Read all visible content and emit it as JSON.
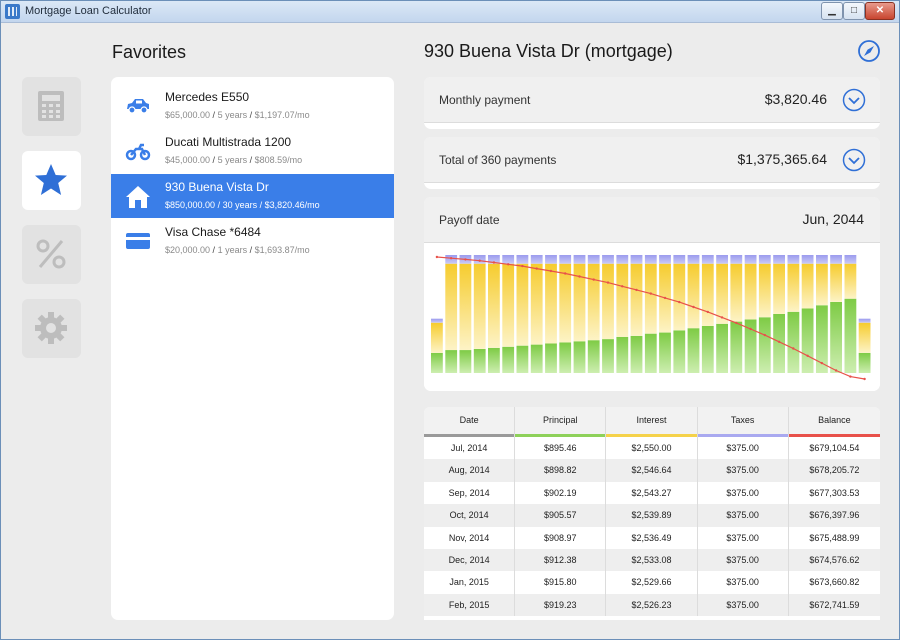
{
  "window": {
    "title": "Mortgage Loan Calculator"
  },
  "nav": [
    {
      "id": "calculator",
      "icon": "calculator-icon",
      "active": false
    },
    {
      "id": "favorites",
      "icon": "star-icon",
      "active": true
    },
    {
      "id": "percent",
      "icon": "percent-icon",
      "active": false
    },
    {
      "id": "settings",
      "icon": "gear-icon",
      "active": false
    }
  ],
  "favorites": {
    "heading": "Favorites",
    "items": [
      {
        "icon": "car-icon",
        "title": "Mercedes E550",
        "amount": "$65,000.00",
        "term": "5 years",
        "payment": "$1,197.07/mo",
        "selected": false
      },
      {
        "icon": "motorcycle-icon",
        "title": "Ducati Multistrada 1200",
        "amount": "$45,000.00",
        "term": "5 years",
        "payment": "$808.59/mo",
        "selected": false
      },
      {
        "icon": "house-icon",
        "title": "930 Buena Vista Dr",
        "amount": "$850,000.00",
        "term": "30 years",
        "payment": "$3,820.46/mo",
        "selected": true
      },
      {
        "icon": "credit-card-icon",
        "title": "Visa Chase *6484",
        "amount": "$20,000.00",
        "term": "1 years",
        "payment": "$1,693.87/mo",
        "selected": false
      }
    ]
  },
  "main": {
    "title": "930 Buena Vista Dr (mortgage)",
    "monthly": {
      "label": "Monthly payment",
      "value": "$3,820.46"
    },
    "total": {
      "label": "Total of 360 payments",
      "value": "$1,375,365.64"
    },
    "payoff": {
      "label": "Payoff date",
      "value": "Jun, 2044"
    }
  },
  "colors": {
    "accent": "#3a7ee8",
    "principal": "#8ed15a",
    "interest": "#f5d24a",
    "taxes": "#a9a9f0",
    "balance": "#e8514a"
  },
  "chart_data": {
    "type": "bar",
    "stacked": true,
    "categories": [
      "1",
      "2",
      "3",
      "4",
      "5",
      "6",
      "7",
      "8",
      "9",
      "10",
      "11",
      "12",
      "13",
      "14",
      "15",
      "16",
      "17",
      "18",
      "19",
      "20",
      "21",
      "22",
      "23",
      "24",
      "25",
      "26",
      "27",
      "28",
      "29",
      "30",
      "31"
    ],
    "series": [
      {
        "name": "Principal",
        "values": [
          0.4,
          0.21,
          0.21,
          0.22,
          0.23,
          0.24,
          0.25,
          0.26,
          0.27,
          0.28,
          0.29,
          0.3,
          0.31,
          0.33,
          0.34,
          0.36,
          0.37,
          0.39,
          0.41,
          0.43,
          0.45,
          0.47,
          0.49,
          0.51,
          0.54,
          0.56,
          0.59,
          0.62,
          0.65,
          0.68,
          0.4
        ]
      },
      {
        "name": "Interest",
        "values": [
          0.6,
          0.79,
          0.79,
          0.78,
          0.77,
          0.76,
          0.75,
          0.74,
          0.73,
          0.72,
          0.71,
          0.7,
          0.69,
          0.67,
          0.66,
          0.64,
          0.63,
          0.61,
          0.59,
          0.57,
          0.55,
          0.53,
          0.51,
          0.49,
          0.46,
          0.44,
          0.41,
          0.38,
          0.35,
          0.32,
          0.6
        ]
      },
      {
        "name": "Taxes",
        "values": [
          0.08,
          0.08,
          0.08,
          0.08,
          0.08,
          0.08,
          0.08,
          0.08,
          0.08,
          0.08,
          0.08,
          0.08,
          0.08,
          0.08,
          0.08,
          0.08,
          0.08,
          0.08,
          0.08,
          0.08,
          0.08,
          0.08,
          0.08,
          0.08,
          0.08,
          0.08,
          0.08,
          0.08,
          0.08,
          0.08,
          0.08
        ]
      }
    ],
    "line": {
      "name": "Balance",
      "values": [
        1.0,
        0.99,
        0.98,
        0.97,
        0.955,
        0.94,
        0.925,
        0.905,
        0.885,
        0.865,
        0.84,
        0.815,
        0.79,
        0.76,
        0.73,
        0.7,
        0.665,
        0.63,
        0.59,
        0.55,
        0.505,
        0.46,
        0.41,
        0.36,
        0.305,
        0.25,
        0.19,
        0.13,
        0.07,
        0.02,
        0.0
      ]
    },
    "partial_bars": [
      0,
      30
    ]
  },
  "table": {
    "headers": [
      "Date",
      "Principal",
      "Interest",
      "Taxes",
      "Balance"
    ],
    "rows": [
      [
        "Jul, 2014",
        "$895.46",
        "$2,550.00",
        "$375.00",
        "$679,104.54"
      ],
      [
        "Aug, 2014",
        "$898.82",
        "$2,546.64",
        "$375.00",
        "$678,205.72"
      ],
      [
        "Sep, 2014",
        "$902.19",
        "$2,543.27",
        "$375.00",
        "$677,303.53"
      ],
      [
        "Oct, 2014",
        "$905.57",
        "$2,539.89",
        "$375.00",
        "$676,397.96"
      ],
      [
        "Nov, 2014",
        "$908.97",
        "$2,536.49",
        "$375.00",
        "$675,488.99"
      ],
      [
        "Dec, 2014",
        "$912.38",
        "$2,533.08",
        "$375.00",
        "$674,576.62"
      ],
      [
        "Jan, 2015",
        "$915.80",
        "$2,529.66",
        "$375.00",
        "$673,660.82"
      ],
      [
        "Feb, 2015",
        "$919.23",
        "$2,526.23",
        "$375.00",
        "$672,741.59"
      ]
    ]
  }
}
